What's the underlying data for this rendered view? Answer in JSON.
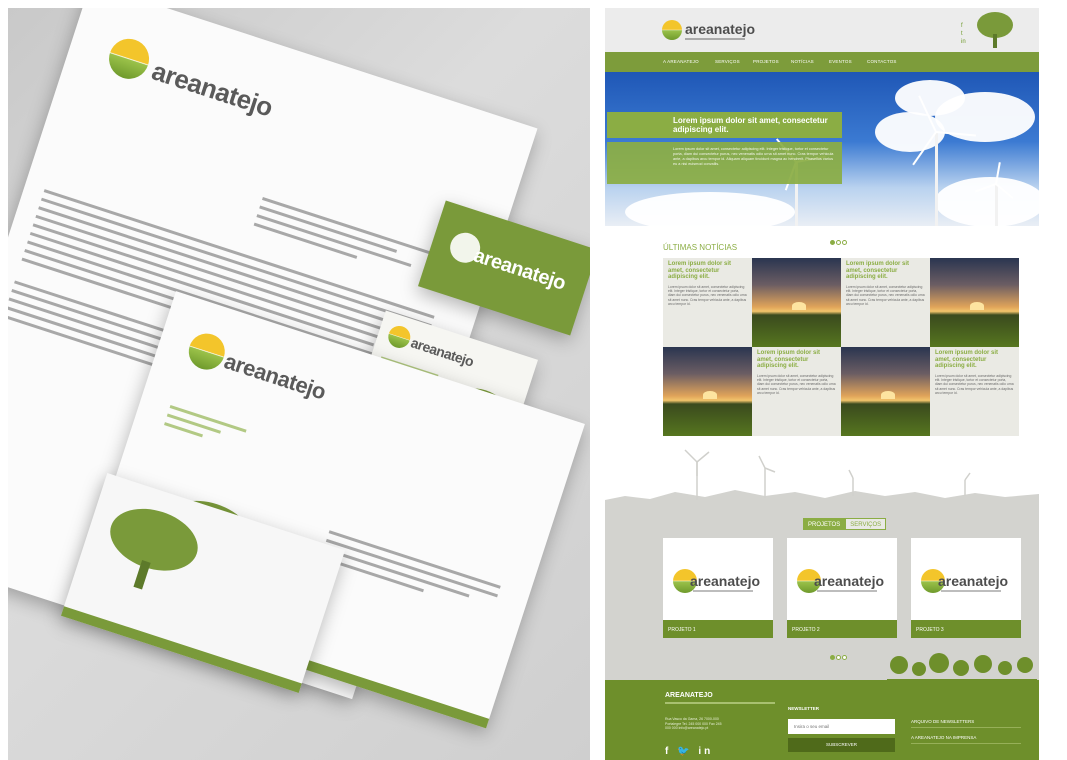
{
  "brand": {
    "name": "areanatejo"
  },
  "website": {
    "nav": [
      "A AREANATEJO",
      "SERVIÇOS",
      "PROJETOS",
      "NOTÍCIAS",
      "EVENTOS",
      "CONTACTOS"
    ],
    "hero": {
      "title": "Lorem ipsum dolor sit amet, consectetur adipiscing elit.",
      "body": "Lorem ipsum dolor sit amet, consectetur adipiscing elit. Integer tristique, tortor et consectetur porta, diam dui consectetur purus, nec venenatis odio urna sit amet nunc. Cras tempor vehicula ante, a dapibus arcu tempor id. Aliquam aliquam tincidunt magna ac hendrerit. Phasellus varius eu a nisi euismod convallis."
    },
    "news": {
      "section_title": "ÚLTIMAS NOTÍCIAS",
      "item_title": "Lorem ipsum dolor sit amet, consectetur adipiscing elit.",
      "item_body": "Lorem ipsum dolor sit amet, consectetur adipiscing elit. Integer tristique, tortor et consectetur porta, diam dui consectetur purus, nec venenatis odio urna sit amet nunc. Cras tempor vehicula ante, a dapibus arcu tempor id."
    },
    "tabs": [
      "PROJETOS",
      "SERVIÇOS"
    ],
    "projects": [
      "PROJETO 1",
      "PROJETO 2",
      "PROJETO 3"
    ],
    "footer": {
      "logo": "AREANATEJO",
      "address": "Rua Vasco da Gama, 26 7000-000 Portalegre Tel. 245 000 000 Fax 245 000 000 info@areanatejo.pt",
      "social": "f 🐦 in",
      "newsletter_title": "NEWSLETTER",
      "email_placeholder": "Insira o seu email",
      "subscribe": "SUBSCREVER",
      "links": [
        "ARQUIVO DE NEWSLETTERS",
        "A AREANATEJO NA IMPRENSA"
      ]
    }
  },
  "colors": {
    "brand_green": "#8bad44",
    "dark_green": "#6e8f2b",
    "sun_yellow": "#f3c52b",
    "grey_text": "#4d4d4d"
  }
}
